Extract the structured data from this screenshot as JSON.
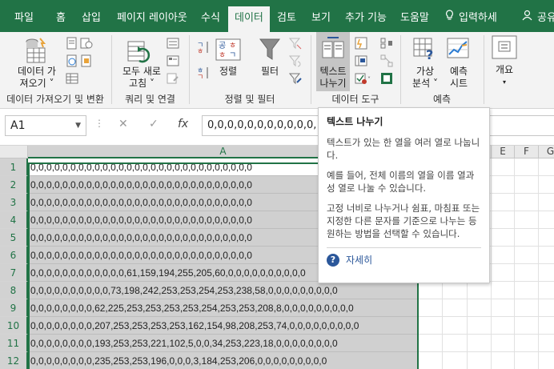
{
  "tabs": [
    {
      "label": "파일"
    },
    {
      "label": "홈"
    },
    {
      "label": "삽입"
    },
    {
      "label": "페이지 레이아웃"
    },
    {
      "label": "수식"
    },
    {
      "label": "데이터"
    },
    {
      "label": "검토"
    },
    {
      "label": "보기"
    },
    {
      "label": "추가 기능"
    },
    {
      "label": "도움말"
    },
    {
      "label": "입력하세"
    },
    {
      "label": "공유"
    }
  ],
  "ribbon": {
    "get_data": {
      "line1": "데이터 가",
      "line2": "져오기 ˅",
      "group": "데이터 가져오기 및 변환"
    },
    "refresh_all": {
      "line1": "모두 새로",
      "line2": "고침 ˅",
      "group": "쿼리 및 연결"
    },
    "sort": {
      "label": "정렬",
      "group": "정렬 및 필터"
    },
    "filter": {
      "label": "필터"
    },
    "text_to_columns": {
      "line1": "텍스트",
      "line2": "나누기",
      "group": "데이터 도구"
    },
    "what_if": {
      "line1": "가상",
      "line2": "분석 ˅",
      "group": "예측"
    },
    "forecast": {
      "line1": "예측",
      "line2": "시트"
    },
    "outline": {
      "label": "개요"
    }
  },
  "formula_bar": {
    "name_box": "A1",
    "formula": "0,0,0,0,0,0,0,0,0,0,0,"
  },
  "columns": {
    "A": "A",
    "E": "E",
    "F": "F",
    "G": "G"
  },
  "rows": [
    {
      "num": "1",
      "value": "0,0,0,0,0,0,0,0,0,0,0,0,0,0,0,0,0,0,0,0,0,0,0,0,0,0,0,0"
    },
    {
      "num": "2",
      "value": "0,0,0,0,0,0,0,0,0,0,0,0,0,0,0,0,0,0,0,0,0,0,0,0,0,0,0,0"
    },
    {
      "num": "3",
      "value": "0,0,0,0,0,0,0,0,0,0,0,0,0,0,0,0,0,0,0,0,0,0,0,0,0,0,0,0"
    },
    {
      "num": "4",
      "value": "0,0,0,0,0,0,0,0,0,0,0,0,0,0,0,0,0,0,0,0,0,0,0,0,0,0,0,0"
    },
    {
      "num": "5",
      "value": "0,0,0,0,0,0,0,0,0,0,0,0,0,0,0,0,0,0,0,0,0,0,0,0,0,0,0,0"
    },
    {
      "num": "6",
      "value": "0,0,0,0,0,0,0,0,0,0,0,0,0,0,0,0,0,0,0,0,0,0,0,0,0,0,0,0"
    },
    {
      "num": "7",
      "value": "0,0,0,0,0,0,0,0,0,0,0,0,61,159,194,255,205,60,0,0,0,0,0,0,0,0,0,0"
    },
    {
      "num": "8",
      "value": "0,0,0,0,0,0,0,0,0,0,73,198,242,253,253,254,253,238,58,0,0,0,0,0,0,0,0,0"
    },
    {
      "num": "9",
      "value": "0,0,0,0,0,0,0,0,62,225,253,253,253,253,254,253,253,208,8,0,0,0,0,0,0,0,0,0"
    },
    {
      "num": "10",
      "value": "0,0,0,0,0,0,0,0,207,253,253,253,253,162,154,98,208,253,74,0,0,0,0,0,0,0,0,0"
    },
    {
      "num": "11",
      "value": "0,0,0,0,0,0,0,0,193,253,253,221,102,5,0,0,34,253,223,18,0,0,0,0,0,0,0,0"
    },
    {
      "num": "12",
      "value": "0,0,0,0,0,0,0,0,235,253,253,196,0,0,0,3,184,253,206,0,0,0,0,0,0,0,0,0"
    }
  ],
  "tooltip": {
    "title": "텍스트 나누기",
    "p1": "텍스트가 있는 한 열을 여러 열로 나눕니다.",
    "p2": "예를 들어, 전체 이름의 열을 이름 열과 성 열로 나눌 수 있습니다.",
    "p3": "고정 너비로 나누거나 쉼표, 마침표 또는 지정한 다른 문자를 기준으로 나누는 등 원하는 방법을 선택할 수 있습니다.",
    "help": "자세히"
  },
  "colors": {
    "brand": "#217346",
    "ribbon_bg": "#f3f3f3",
    "selection": "#d0d0d0",
    "help_blue": "#2b579a"
  }
}
